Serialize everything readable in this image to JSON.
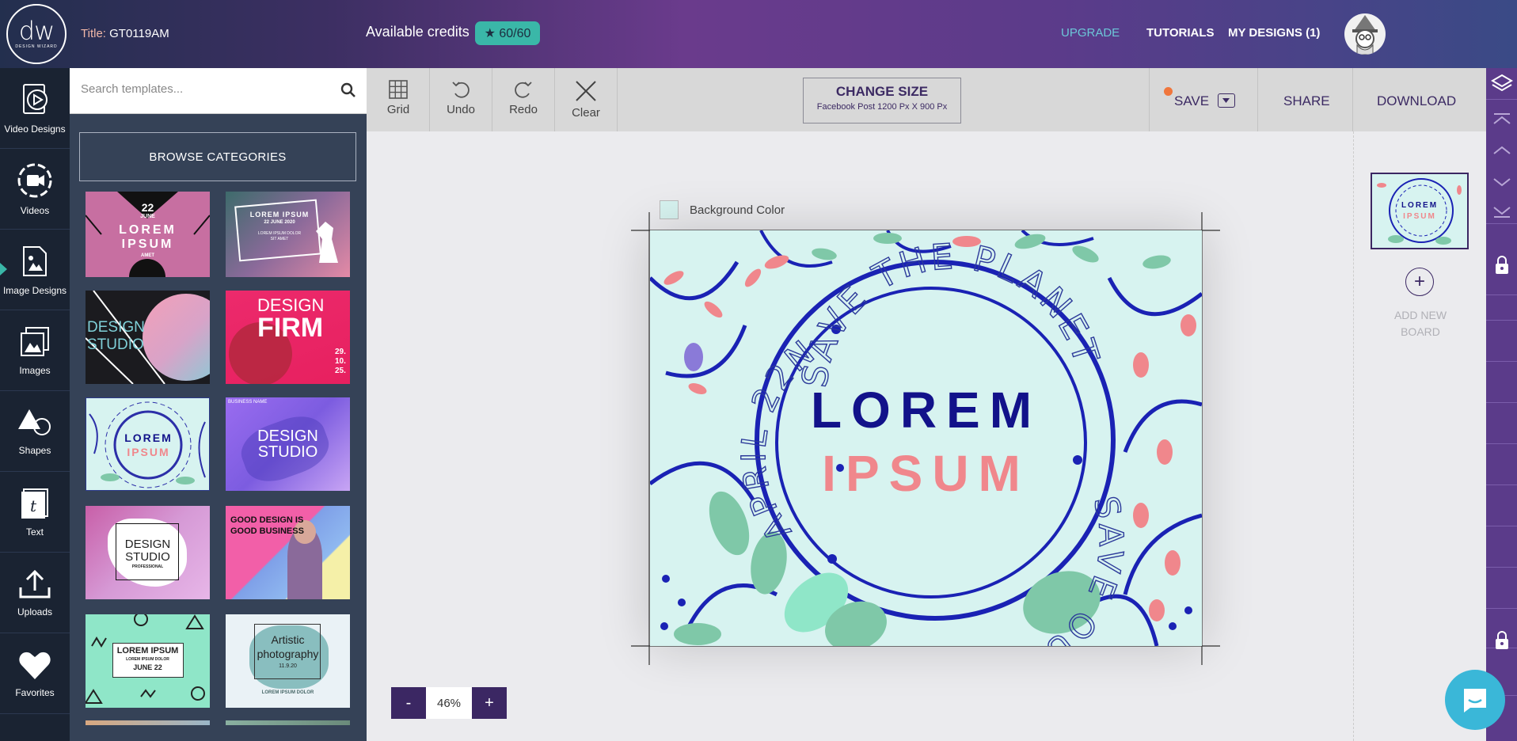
{
  "header": {
    "logo_text": "dw",
    "logo_sub": "DESIGN WIZARD",
    "title_label": "Title:",
    "title_value": "GT0119AM",
    "credits_label": "Available credits",
    "credits_value": "★ 60/60",
    "nav": [
      "UPGRADE",
      "TUTORIALS",
      "MY DESIGNS (1)"
    ],
    "accent_color": "#3ab7a8"
  },
  "sidebar": {
    "items": [
      {
        "label": "Video Designs",
        "icon": "video-design-icon"
      },
      {
        "label": "Videos",
        "icon": "video-camera-icon"
      },
      {
        "label": "Image Designs",
        "icon": "image-design-icon"
      },
      {
        "label": "Images",
        "icon": "images-icon"
      },
      {
        "label": "Shapes",
        "icon": "shapes-icon"
      },
      {
        "label": "Text",
        "icon": "text-icon"
      },
      {
        "label": "Uploads",
        "icon": "upload-icon"
      },
      {
        "label": "Favorites",
        "icon": "heart-icon"
      }
    ]
  },
  "panel": {
    "search_placeholder": "Search templates...",
    "browse_label": "BROWSE CATEGORIES",
    "templates": [
      {
        "lines": [
          "22",
          "JUNE",
          "LOREM",
          "IPSUM",
          "AMET"
        ]
      },
      {
        "lines": [
          "LOREM IPSUM",
          "22 JUNE 2020",
          "LOREM IPSUM DOLOR",
          "SIT AMET"
        ]
      },
      {
        "lines": [
          "DESIGN",
          "STUDIO"
        ]
      },
      {
        "lines": [
          "DESIGN",
          "FIRM",
          "29.",
          "10.",
          "25."
        ]
      },
      {
        "lines": [
          "LOREM",
          "IPSUM"
        ]
      },
      {
        "lines": [
          "BUSINESS NAME",
          "DESIGN",
          "STUDIO"
        ]
      },
      {
        "lines": [
          "DESIGN",
          "STUDIO",
          "PROFESSIONAL"
        ]
      },
      {
        "lines": [
          "GOOD DESIGN IS",
          "GOOD BUSINESS"
        ]
      },
      {
        "lines": [
          "LOREM IPSUM",
          "LOREM IPSUM DOLOR",
          "JUNE 22"
        ]
      },
      {
        "lines": [
          "Artistic",
          "photography",
          "11.9.20",
          "LOREM IPSUM DOLOR"
        ]
      }
    ]
  },
  "toolbar": {
    "tools": [
      "Grid",
      "Undo",
      "Redo",
      "Clear"
    ],
    "change_size": "CHANGE SIZE",
    "size_detail": "Facebook Post 1200 Px X 900 Px",
    "save": "SAVE",
    "share": "SHARE",
    "download": "DOWNLOAD"
  },
  "canvas": {
    "bg_label": "Background Color",
    "bg_color": "#d7f3f0",
    "arc_top": "SAVE THE PLANET",
    "arc_left": "APRIL 22ND",
    "arc_bottom": "SAVE OUR HOME",
    "title1": "LOREM",
    "title2": "IPSUM",
    "title1_color": "#12128a",
    "title2_color": "#f0878c"
  },
  "zoom": {
    "minus": "-",
    "value": "46%",
    "plus": "+"
  },
  "boards": {
    "add_label": "ADD NEW BOARD",
    "add_icon": "+"
  }
}
